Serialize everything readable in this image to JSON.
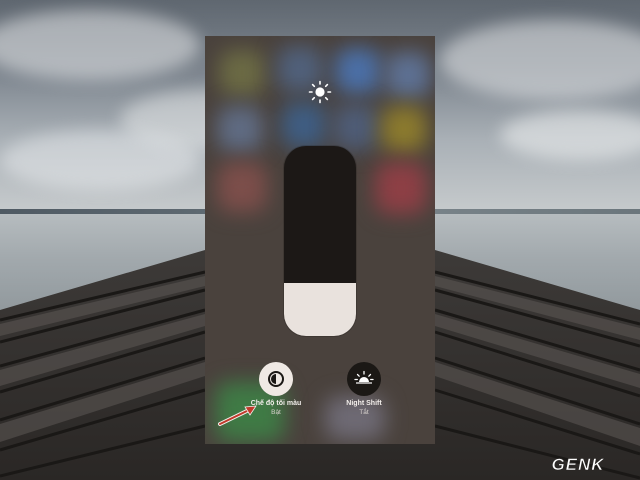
{
  "control_center": {
    "brightness_level": 0.28,
    "dark_mode": {
      "label": "Chế độ tối màu",
      "state": "Bật"
    },
    "night_shift": {
      "label": "Night Shift",
      "state": "Tắt"
    }
  },
  "icons": {
    "brightness": "sun-icon",
    "dark_mode": "dark-mode-icon",
    "night_shift": "night-shift-sun-icon",
    "annotation": "arrow-annotation"
  },
  "watermark": {
    "text": "GENK"
  },
  "colors": {
    "panel_bg": "#4a423d",
    "slider_track": "#1c1816",
    "slider_fill": "#e9e2dd",
    "arrow": "#c0392b"
  }
}
